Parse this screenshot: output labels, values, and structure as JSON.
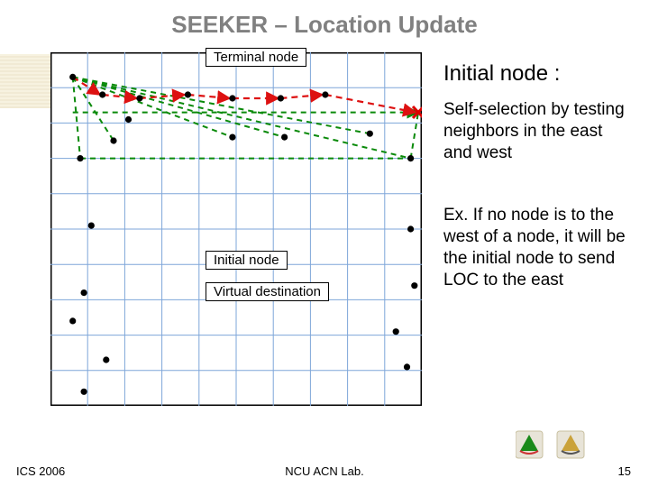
{
  "title": "SEEKER – Location Update",
  "labels": {
    "terminal": "Terminal node",
    "initial": "Initial node",
    "virtual": "Virtual destination"
  },
  "right": {
    "heading": "Initial node :",
    "p1": "Self-selection by testing neighbors in the east and west",
    "p2": "Ex. If no node is to the west of a node, it will be the initial node to send LOC to the east"
  },
  "footer": {
    "left": "ICS 2006",
    "center": "NCU ACN Lab.",
    "page": "15"
  },
  "chart_data": {
    "type": "scatter",
    "title": "SEEKER location update diagram",
    "grid": {
      "cols": 10,
      "rows": 10,
      "xrange": [
        0,
        10
      ],
      "yrange": [
        0,
        10
      ]
    },
    "nodes": [
      {
        "x": 0.6,
        "y": 9.3
      },
      {
        "x": 1.4,
        "y": 8.8
      },
      {
        "x": 2.4,
        "y": 8.7
      },
      {
        "x": 3.7,
        "y": 8.8
      },
      {
        "x": 4.9,
        "y": 8.7
      },
      {
        "x": 6.2,
        "y": 8.7
      },
      {
        "x": 7.4,
        "y": 8.8
      },
      {
        "x": 2.1,
        "y": 8.1
      },
      {
        "x": 1.7,
        "y": 7.5
      },
      {
        "x": 4.9,
        "y": 7.6
      },
      {
        "x": 6.3,
        "y": 7.6
      },
      {
        "x": 8.6,
        "y": 7.7
      },
      {
        "x": 0.8,
        "y": 7.0
      },
      {
        "x": 9.7,
        "y": 7.0
      },
      {
        "x": 1.1,
        "y": 5.1
      },
      {
        "x": 9.7,
        "y": 5.0
      },
      {
        "x": 0.9,
        "y": 3.2
      },
      {
        "x": 9.8,
        "y": 3.4
      },
      {
        "x": 0.6,
        "y": 2.4
      },
      {
        "x": 9.3,
        "y": 2.1
      },
      {
        "x": 1.5,
        "y": 1.3
      },
      {
        "x": 9.6,
        "y": 1.1
      },
      {
        "x": 0.9,
        "y": 0.4
      }
    ],
    "initial_node": {
      "x": 0.6,
      "y": 9.3,
      "note": "leftmost top node — nothing to its west"
    },
    "terminal_nodes_row_y": 8.7,
    "virtual_destination": {
      "x": 10.2,
      "y": 8.3,
      "marker": "red-x"
    },
    "greedy_path_east": [
      {
        "x": 0.6,
        "y": 9.3
      },
      {
        "x": 1.4,
        "y": 8.8
      },
      {
        "x": 2.4,
        "y": 8.7
      },
      {
        "x": 3.7,
        "y": 8.8
      },
      {
        "x": 4.9,
        "y": 8.7
      },
      {
        "x": 6.2,
        "y": 8.7
      },
      {
        "x": 7.4,
        "y": 8.8
      },
      {
        "x": 10.2,
        "y": 8.3
      }
    ],
    "direct_line_to_virtual": {
      "from": {
        "x": 0.6,
        "y": 9.3
      },
      "to": {
        "x": 10.2,
        "y": 8.3
      },
      "style": "dashed-green"
    },
    "fan_reference_lines": [
      {
        "from": {
          "x": 0.6,
          "y": 9.3
        },
        "to": {
          "x": 0.8,
          "y": 7.0
        }
      },
      {
        "from": {
          "x": 0.6,
          "y": 9.3
        },
        "to": {
          "x": 1.7,
          "y": 7.5
        }
      },
      {
        "from": {
          "x": 0.6,
          "y": 9.3
        },
        "to": {
          "x": 4.9,
          "y": 7.6
        }
      },
      {
        "from": {
          "x": 0.6,
          "y": 9.3
        },
        "to": {
          "x": 6.3,
          "y": 7.6
        }
      },
      {
        "from": {
          "x": 0.6,
          "y": 9.3
        },
        "to": {
          "x": 8.6,
          "y": 7.7
        }
      },
      {
        "from": {
          "x": 0.6,
          "y": 9.3
        },
        "to": {
          "x": 9.7,
          "y": 7.0
        }
      }
    ]
  }
}
